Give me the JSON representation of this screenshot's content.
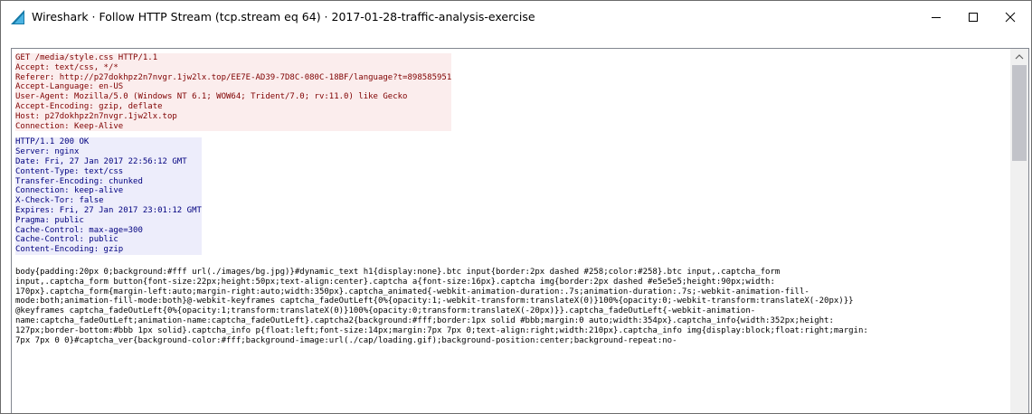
{
  "window": {
    "title": "Wireshark · Follow HTTP Stream (tcp.stream eq 64) · 2017-01-28-traffic-analysis-exercise",
    "app_icon": "wireshark-fin-icon",
    "controls": {
      "minimize": "minimize-icon",
      "maximize": "maximize-icon",
      "close": "close-icon"
    }
  },
  "colors": {
    "client_text": "#7f0000",
    "client_bg": "#fbeded",
    "server_text": "#00007f",
    "server_bg": "#ededfb"
  },
  "stream": {
    "request_lines": [
      "GET /media/style.css HTTP/1.1",
      "Accept: text/css, */*",
      "Referer: http://p27dokhpz2n7nvgr.1jw2lx.top/EE7E-AD39-7D8C-080C-18BF/language?t=898585951",
      "Accept-Language: en-US",
      "User-Agent: Mozilla/5.0 (Windows NT 6.1; WOW64; Trident/7.0; rv:11.0) like Gecko",
      "Accept-Encoding: gzip, deflate",
      "Host: p27dokhpz2n7nvgr.1jw2lx.top",
      "Connection: Keep-Alive"
    ],
    "response_lines": [
      "HTTP/1.1 200 OK",
      "Server: nginx",
      "Date: Fri, 27 Jan 2017 22:56:12 GMT",
      "Content-Type: text/css",
      "Transfer-Encoding: chunked",
      "Connection: keep-alive",
      "X-Check-Tor: false",
      "Expires: Fri, 27 Jan 2017 23:01:12 GMT",
      "Pragma: public",
      "Cache-Control: max-age=300",
      "Cache-Control: public",
      "Content-Encoding: gzip"
    ],
    "body_lines": [
      "body{padding:20px 0;background:#fff url(./images/bg.jpg)}#dynamic_text h1{display:none}.btc input{border:2px dashed #258;color:#258}.btc input,.captcha_form",
      "input,.captcha_form button{font-size:22px;height:50px;text-align:center}.captcha a{font-size:16px}.captcha img{border:2px dashed #e5e5e5;height:90px;width:",
      "170px}.captcha_form{margin-left:auto;margin-right:auto;width:350px}.captcha_animated{-webkit-animation-duration:.7s;animation-duration:.7s;-webkit-animation-fill-",
      "mode:both;animation-fill-mode:both}@-webkit-keyframes captcha_fadeOutLeft{0%{opacity:1;-webkit-transform:translateX(0)}100%{opacity:0;-webkit-transform:translateX(-20px)}}",
      "@keyframes captcha_fadeOutLeft{0%{opacity:1;transform:translateX(0)}100%{opacity:0;transform:translateX(-20px)}}.captcha_fadeOutLeft{-webkit-animation-",
      "name:captcha_fadeOutLeft;animation-name:captcha_fadeOutLeft}.captcha2{background:#fff;border:1px solid #bbb;margin:0 auto;width:354px}.captcha_info{width:352px;height:",
      "127px;border-bottom:#bbb 1px solid}.captcha_info p{float:left;font-size:14px;margin:7px 7px 0;text-align:right;width:210px}.captcha_info img{display:block;float:right;margin:",
      "7px 7px 0 0}#captcha_ver{background-color:#fff;background-image:url(./cap/loading.gif);background-position:center;background-repeat:no-"
    ]
  },
  "scrollbar": {
    "up_icon": "scroll-up-arrow-icon",
    "position": 0.0
  }
}
